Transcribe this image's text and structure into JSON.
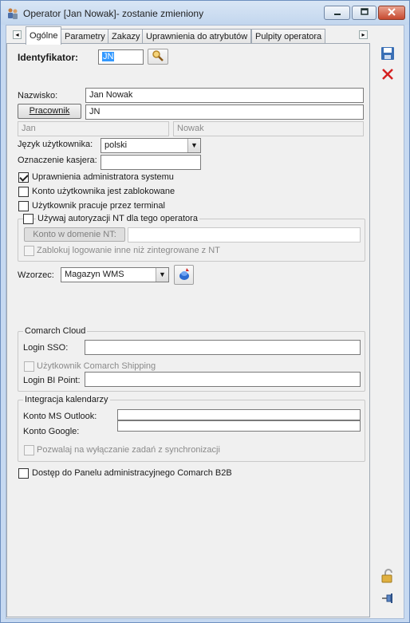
{
  "window": {
    "title": "Operator [Jan Nowak]- zostanie zmieniony"
  },
  "tabs": [
    {
      "label": "Ogólne",
      "active": true
    },
    {
      "label": "Parametry"
    },
    {
      "label": "Zakazy"
    },
    {
      "label": "Uprawnienia do atrybutów"
    },
    {
      "label": "Pulpity operatora"
    }
  ],
  "form": {
    "identyfikator_label": "Identyfikator:",
    "identyfikator_value": "JN",
    "nazwisko_label": "Nazwisko:",
    "nazwisko_value": "Jan Nowak",
    "pracownik_button": "Pracownik",
    "pracownik_value": "JN",
    "first_name": "Jan",
    "last_name": "Nowak",
    "jezyk_label": "Język użytkownika:",
    "jezyk_value": "polski",
    "kasjer_label": "Oznaczenie kasjera:",
    "kasjer_value": "",
    "admin_label": "Uprawnienia administratora systemu",
    "admin_checked": true,
    "zablokowane_label": "Konto użytkownika jest zablokowane",
    "terminal_label": "Użytkownik pracuje przez terminal"
  },
  "nt_group": {
    "checkbox_label": "Używaj autoryzacji NT dla tego operatora",
    "konto_button": "Konto w domenie NT:",
    "konto_value": "",
    "zablokuj_label": "Zablokuj logowanie inne niż zintegrowane z NT"
  },
  "wzorzec": {
    "label": "Wzorzec:",
    "value": "Magazyn WMS"
  },
  "cloud_group": {
    "title": "Comarch Cloud",
    "login_sso_label": "Login SSO:",
    "login_sso_value": "",
    "shipping_label": "Użytkownik Comarch Shipping",
    "login_bi_label": "Login BI Point:",
    "login_bi_value": ""
  },
  "calendar_group": {
    "title": "Integracja kalendarzy",
    "outlook_label": "Konto MS Outlook:",
    "outlook_value": "",
    "google_label": "Konto Google:",
    "google_value": "",
    "pozwalaj_label": "Pozwalaj na wyłączanie zadań z synchronizacji"
  },
  "b2b": {
    "label": "Dostęp do Panelu administracyjnego Comarch B2B"
  },
  "colors": {
    "title_bar": "#c6d9f1",
    "close_button": "#c74a30",
    "save_icon": "#3a6fb5",
    "cancel_icon": "#d42020"
  },
  "icons": [
    "operator-icon",
    "minimize-icon",
    "maximize-icon",
    "close-icon",
    "tab-left-arrow-icon",
    "tab-right-arrow-icon",
    "search-icon",
    "pattern-apply-icon",
    "save-icon",
    "cancel-icon",
    "lock-icon",
    "pin-icon"
  ]
}
